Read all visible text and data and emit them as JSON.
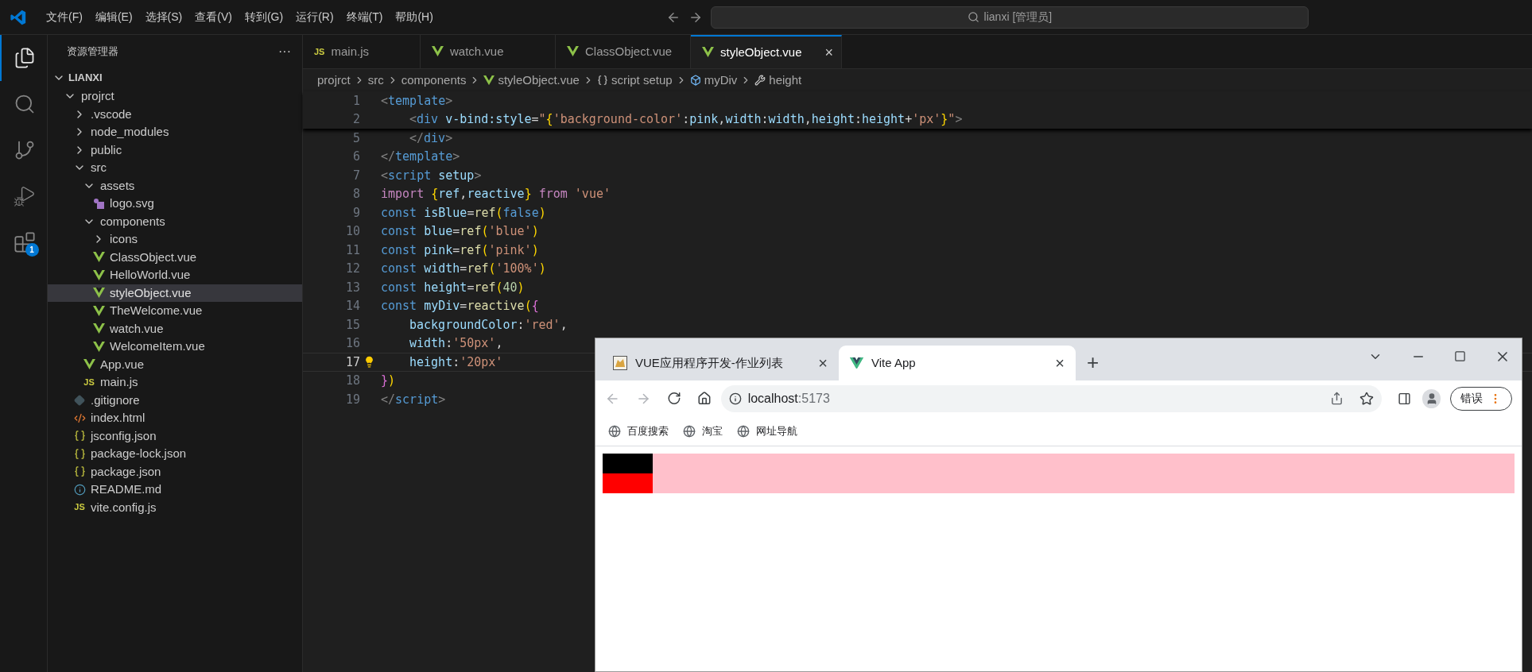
{
  "title_bar": {
    "menus": [
      "文件(F)",
      "编辑(E)",
      "选择(S)",
      "查看(V)",
      "转到(G)",
      "运行(R)",
      "终端(T)",
      "帮助(H)"
    ],
    "command_center": "lianxi [管理员]"
  },
  "activity_bar": [
    {
      "kind": "explorer",
      "selected": true
    },
    {
      "kind": "search",
      "selected": false
    },
    {
      "kind": "source-control",
      "selected": false
    },
    {
      "kind": "run",
      "selected": false
    },
    {
      "kind": "extensions",
      "selected": false,
      "badge": "1"
    }
  ],
  "explorer": {
    "title": "资源管理器",
    "more": "···",
    "workspace": "LIANXI",
    "tree": [
      {
        "name": "projrct",
        "kind": "folder",
        "expanded": true,
        "selected": false,
        "children": [
          {
            "name": ".vscode",
            "kind": "folder",
            "expanded": false,
            "selected": false
          },
          {
            "name": "node_modules",
            "kind": "folder",
            "expanded": false,
            "selected": false
          },
          {
            "name": "public",
            "kind": "folder",
            "expanded": false,
            "selected": false
          },
          {
            "name": "src",
            "kind": "folder",
            "expanded": true,
            "selected": false,
            "children": [
              {
                "name": "assets",
                "kind": "folder",
                "expanded": true,
                "selected": false,
                "children": [
                  {
                    "name": "logo.svg",
                    "kind": "svg",
                    "selected": false
                  }
                ]
              },
              {
                "name": "components",
                "kind": "folder",
                "expanded": true,
                "selected": false,
                "children": [
                  {
                    "name": "icons",
                    "kind": "folder",
                    "expanded": false,
                    "selected": false
                  },
                  {
                    "name": "ClassObject.vue",
                    "kind": "vue",
                    "selected": false
                  },
                  {
                    "name": "HelloWorld.vue",
                    "kind": "vue",
                    "selected": false
                  },
                  {
                    "name": "styleObject.vue",
                    "kind": "vue",
                    "selected": true
                  },
                  {
                    "name": "TheWelcome.vue",
                    "kind": "vue",
                    "selected": false
                  },
                  {
                    "name": "watch.vue",
                    "kind": "vue",
                    "selected": false
                  },
                  {
                    "name": "WelcomeItem.vue",
                    "kind": "vue",
                    "selected": false
                  }
                ]
              },
              {
                "name": "App.vue",
                "kind": "vue",
                "selected": false
              },
              {
                "name": "main.js",
                "kind": "js",
                "icon_label": "JS",
                "selected": false
              }
            ]
          },
          {
            "name": ".gitignore",
            "kind": "git",
            "selected": false
          },
          {
            "name": "index.html",
            "kind": "html",
            "selected": false
          },
          {
            "name": "jsconfig.json",
            "kind": "json",
            "selected": false
          },
          {
            "name": "package-lock.json",
            "kind": "json",
            "selected": false
          },
          {
            "name": "package.json",
            "kind": "json",
            "selected": false
          },
          {
            "name": "README.md",
            "kind": "info",
            "selected": false
          },
          {
            "name": "vite.config.js",
            "kind": "js",
            "icon_label": "JS",
            "selected": false
          }
        ]
      }
    ]
  },
  "editor_tabs": [
    {
      "label": "main.js",
      "kind": "js",
      "icon_label": "JS",
      "selected": false
    },
    {
      "label": "watch.vue",
      "kind": "vue",
      "selected": false
    },
    {
      "label": "ClassObject.vue",
      "kind": "vue",
      "selected": false
    },
    {
      "label": "styleObject.vue",
      "kind": "vue",
      "selected": true,
      "close": "×"
    }
  ],
  "breadcrumbs": [
    {
      "text": "projrct",
      "kind": "folder"
    },
    {
      "text": "src",
      "kind": "folder"
    },
    {
      "text": "components",
      "kind": "folder"
    },
    {
      "text": "styleObject.vue",
      "kind": "vue"
    },
    {
      "text": "script setup",
      "kind": "braces"
    },
    {
      "text": "myDiv",
      "kind": "variable"
    },
    {
      "text": "height",
      "kind": "property"
    }
  ],
  "sticky_code": [
    {
      "number": "1",
      "current": false,
      "indented": false,
      "tokens": [
        {
          "kind": "punct",
          "text": "<"
        },
        {
          "kind": "tag",
          "text": "template"
        },
        {
          "kind": "punct",
          "text": ">"
        }
      ]
    },
    {
      "number": "2",
      "current": false,
      "indented": true,
      "tokens": [
        {
          "kind": "punct",
          "text": "<"
        },
        {
          "kind": "tag",
          "text": "div"
        },
        {
          "kind": "attr",
          "text": " v-bind:style"
        },
        {
          "kind": "plain",
          "text": "="
        },
        {
          "kind": "string",
          "text": "\""
        },
        {
          "kind": "bracket",
          "text": "{"
        },
        {
          "kind": "string",
          "text": "'background-color'"
        },
        {
          "kind": "plain",
          "text": ":"
        },
        {
          "kind": "var",
          "text": "pink"
        },
        {
          "kind": "plain",
          "text": ","
        },
        {
          "kind": "var",
          "text": "width"
        },
        {
          "kind": "plain",
          "text": ":"
        },
        {
          "kind": "var",
          "text": "width"
        },
        {
          "kind": "plain",
          "text": ","
        },
        {
          "kind": "var",
          "text": "height"
        },
        {
          "kind": "plain",
          "text": ":"
        },
        {
          "kind": "var",
          "text": "height"
        },
        {
          "kind": "plain",
          "text": "+"
        },
        {
          "kind": "string",
          "text": "'px'"
        },
        {
          "kind": "bracket",
          "text": "}"
        },
        {
          "kind": "string",
          "text": "\""
        },
        {
          "kind": "punct",
          "text": ">"
        }
      ]
    }
  ],
  "code": [
    {
      "number": "5",
      "current": false,
      "indented": true,
      "tokens": [
        {
          "kind": "punct",
          "text": "</"
        },
        {
          "kind": "tag",
          "text": "div"
        },
        {
          "kind": "punct",
          "text": ">"
        }
      ]
    },
    {
      "number": "6",
      "current": false,
      "indented": false,
      "tokens": [
        {
          "kind": "punct",
          "text": "</"
        },
        {
          "kind": "tag",
          "text": "template"
        },
        {
          "kind": "punct",
          "text": ">"
        }
      ]
    },
    {
      "number": "7",
      "current": false,
      "indented": false,
      "tokens": [
        {
          "kind": "punct",
          "text": "<"
        },
        {
          "kind": "tag",
          "text": "script"
        },
        {
          "kind": "attr",
          "text": " setup"
        },
        {
          "kind": "punct",
          "text": ">"
        }
      ]
    },
    {
      "number": "8",
      "current": false,
      "indented": false,
      "tokens": [
        {
          "kind": "keyword",
          "text": "import "
        },
        {
          "kind": "bracket",
          "text": "{"
        },
        {
          "kind": "var",
          "text": "ref"
        },
        {
          "kind": "plain",
          "text": ","
        },
        {
          "kind": "var",
          "text": "reactive"
        },
        {
          "kind": "bracket",
          "text": "}"
        },
        {
          "kind": "keyword",
          "text": " from "
        },
        {
          "kind": "string",
          "text": "'vue'"
        }
      ]
    },
    {
      "number": "9",
      "current": false,
      "indented": false,
      "tokens": [
        {
          "kind": "storage",
          "text": "const "
        },
        {
          "kind": "var",
          "text": "isBlue"
        },
        {
          "kind": "plain",
          "text": "="
        },
        {
          "kind": "func",
          "text": "ref"
        },
        {
          "kind": "bracket",
          "text": "("
        },
        {
          "kind": "storage",
          "text": "false"
        },
        {
          "kind": "bracket",
          "text": ")"
        }
      ]
    },
    {
      "number": "10",
      "current": false,
      "indented": false,
      "tokens": [
        {
          "kind": "storage",
          "text": "const "
        },
        {
          "kind": "var",
          "text": "blue"
        },
        {
          "kind": "plain",
          "text": "="
        },
        {
          "kind": "func",
          "text": "ref"
        },
        {
          "kind": "bracket",
          "text": "("
        },
        {
          "kind": "string",
          "text": "'blue'"
        },
        {
          "kind": "bracket",
          "text": ")"
        }
      ]
    },
    {
      "number": "11",
      "current": false,
      "indented": false,
      "tokens": [
        {
          "kind": "storage",
          "text": "const "
        },
        {
          "kind": "var",
          "text": "pink"
        },
        {
          "kind": "plain",
          "text": "="
        },
        {
          "kind": "func",
          "text": "ref"
        },
        {
          "kind": "bracket",
          "text": "("
        },
        {
          "kind": "string",
          "text": "'pink'"
        },
        {
          "kind": "bracket",
          "text": ")"
        }
      ]
    },
    {
      "number": "12",
      "current": false,
      "indented": false,
      "tokens": [
        {
          "kind": "storage",
          "text": "const "
        },
        {
          "kind": "var",
          "text": "width"
        },
        {
          "kind": "plain",
          "text": "="
        },
        {
          "kind": "func",
          "text": "ref"
        },
        {
          "kind": "bracket",
          "text": "("
        },
        {
          "kind": "string",
          "text": "'100%'"
        },
        {
          "kind": "bracket",
          "text": ")"
        }
      ]
    },
    {
      "number": "13",
      "current": false,
      "indented": false,
      "tokens": [
        {
          "kind": "storage",
          "text": "const "
        },
        {
          "kind": "var",
          "text": "height"
        },
        {
          "kind": "plain",
          "text": "="
        },
        {
          "kind": "func",
          "text": "ref"
        },
        {
          "kind": "bracket",
          "text": "("
        },
        {
          "kind": "number",
          "text": "40"
        },
        {
          "kind": "bracket",
          "text": ")"
        }
      ]
    },
    {
      "number": "14",
      "current": false,
      "indented": false,
      "tokens": [
        {
          "kind": "storage",
          "text": "const "
        },
        {
          "kind": "var",
          "text": "myDiv"
        },
        {
          "kind": "plain",
          "text": "="
        },
        {
          "kind": "func",
          "text": "reactive"
        },
        {
          "kind": "bracket",
          "text": "("
        },
        {
          "kind": "bracket2",
          "text": "{"
        }
      ]
    },
    {
      "number": "15",
      "current": false,
      "indented": true,
      "tokens": [
        {
          "kind": "var",
          "text": "backgroundColor"
        },
        {
          "kind": "plain",
          "text": ":"
        },
        {
          "kind": "string",
          "text": "'red'"
        },
        {
          "kind": "plain",
          "text": ","
        }
      ]
    },
    {
      "number": "16",
      "current": false,
      "indented": true,
      "tokens": [
        {
          "kind": "var",
          "text": "width"
        },
        {
          "kind": "plain",
          "text": ":"
        },
        {
          "kind": "string",
          "text": "'50px'"
        },
        {
          "kind": "plain",
          "text": ","
        }
      ]
    },
    {
      "number": "17",
      "current": true,
      "indented": true,
      "tokens": [
        {
          "kind": "var",
          "text": "height"
        },
        {
          "kind": "plain",
          "text": ":"
        },
        {
          "kind": "string",
          "text": "'20px'"
        }
      ]
    },
    {
      "number": "18",
      "current": false,
      "indented": false,
      "tokens": [
        {
          "kind": "bracket2",
          "text": "}"
        },
        {
          "kind": "bracket",
          "text": ")"
        }
      ]
    },
    {
      "number": "19",
      "current": false,
      "indented": false,
      "tokens": [
        {
          "kind": "punct",
          "text": "</"
        },
        {
          "kind": "tag",
          "text": "script"
        },
        {
          "kind": "punct",
          "text": ">"
        }
      ]
    }
  ],
  "browser": {
    "tabs": [
      {
        "title": "VUE应用程序开发-作业列表",
        "kind": "cat",
        "selected": false,
        "close": "×"
      },
      {
        "title": "Vite App",
        "kind": "vue",
        "selected": true,
        "close": "×"
      }
    ],
    "new_tab": "+",
    "address_host": "localhost",
    "address_port": ":5173",
    "profile_button": "错误",
    "bookmarks": [
      "百度搜索",
      "淘宝",
      "网址导航"
    ]
  }
}
